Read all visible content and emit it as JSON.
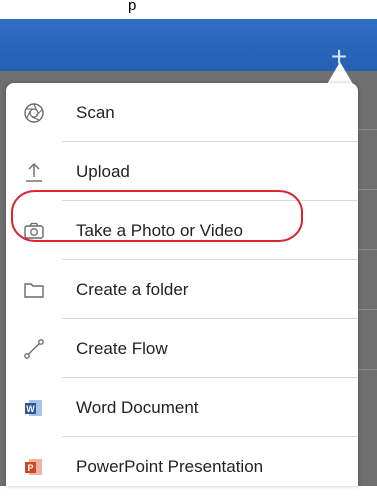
{
  "header": {
    "caption": "p",
    "add_button_glyph": "+",
    "header_color": "#2a67bb"
  },
  "menu": {
    "items": [
      {
        "label": "Scan",
        "icon": "scan-aperture-icon"
      },
      {
        "label": "Upload",
        "icon": "upload-arrow-icon"
      },
      {
        "label": "Take a Photo or Video",
        "icon": "camera-icon",
        "highlighted": true
      },
      {
        "label": "Create a folder",
        "icon": "folder-icon"
      },
      {
        "label": "Create Flow",
        "icon": "flow-icon"
      },
      {
        "label": "Word Document",
        "icon": "word-icon"
      },
      {
        "label": "PowerPoint Presentation",
        "icon": "powerpoint-icon"
      }
    ]
  },
  "colors": {
    "highlight_ring": "#d9262c",
    "word_blue": "#2b579a",
    "powerpoint_orange": "#d24726"
  }
}
